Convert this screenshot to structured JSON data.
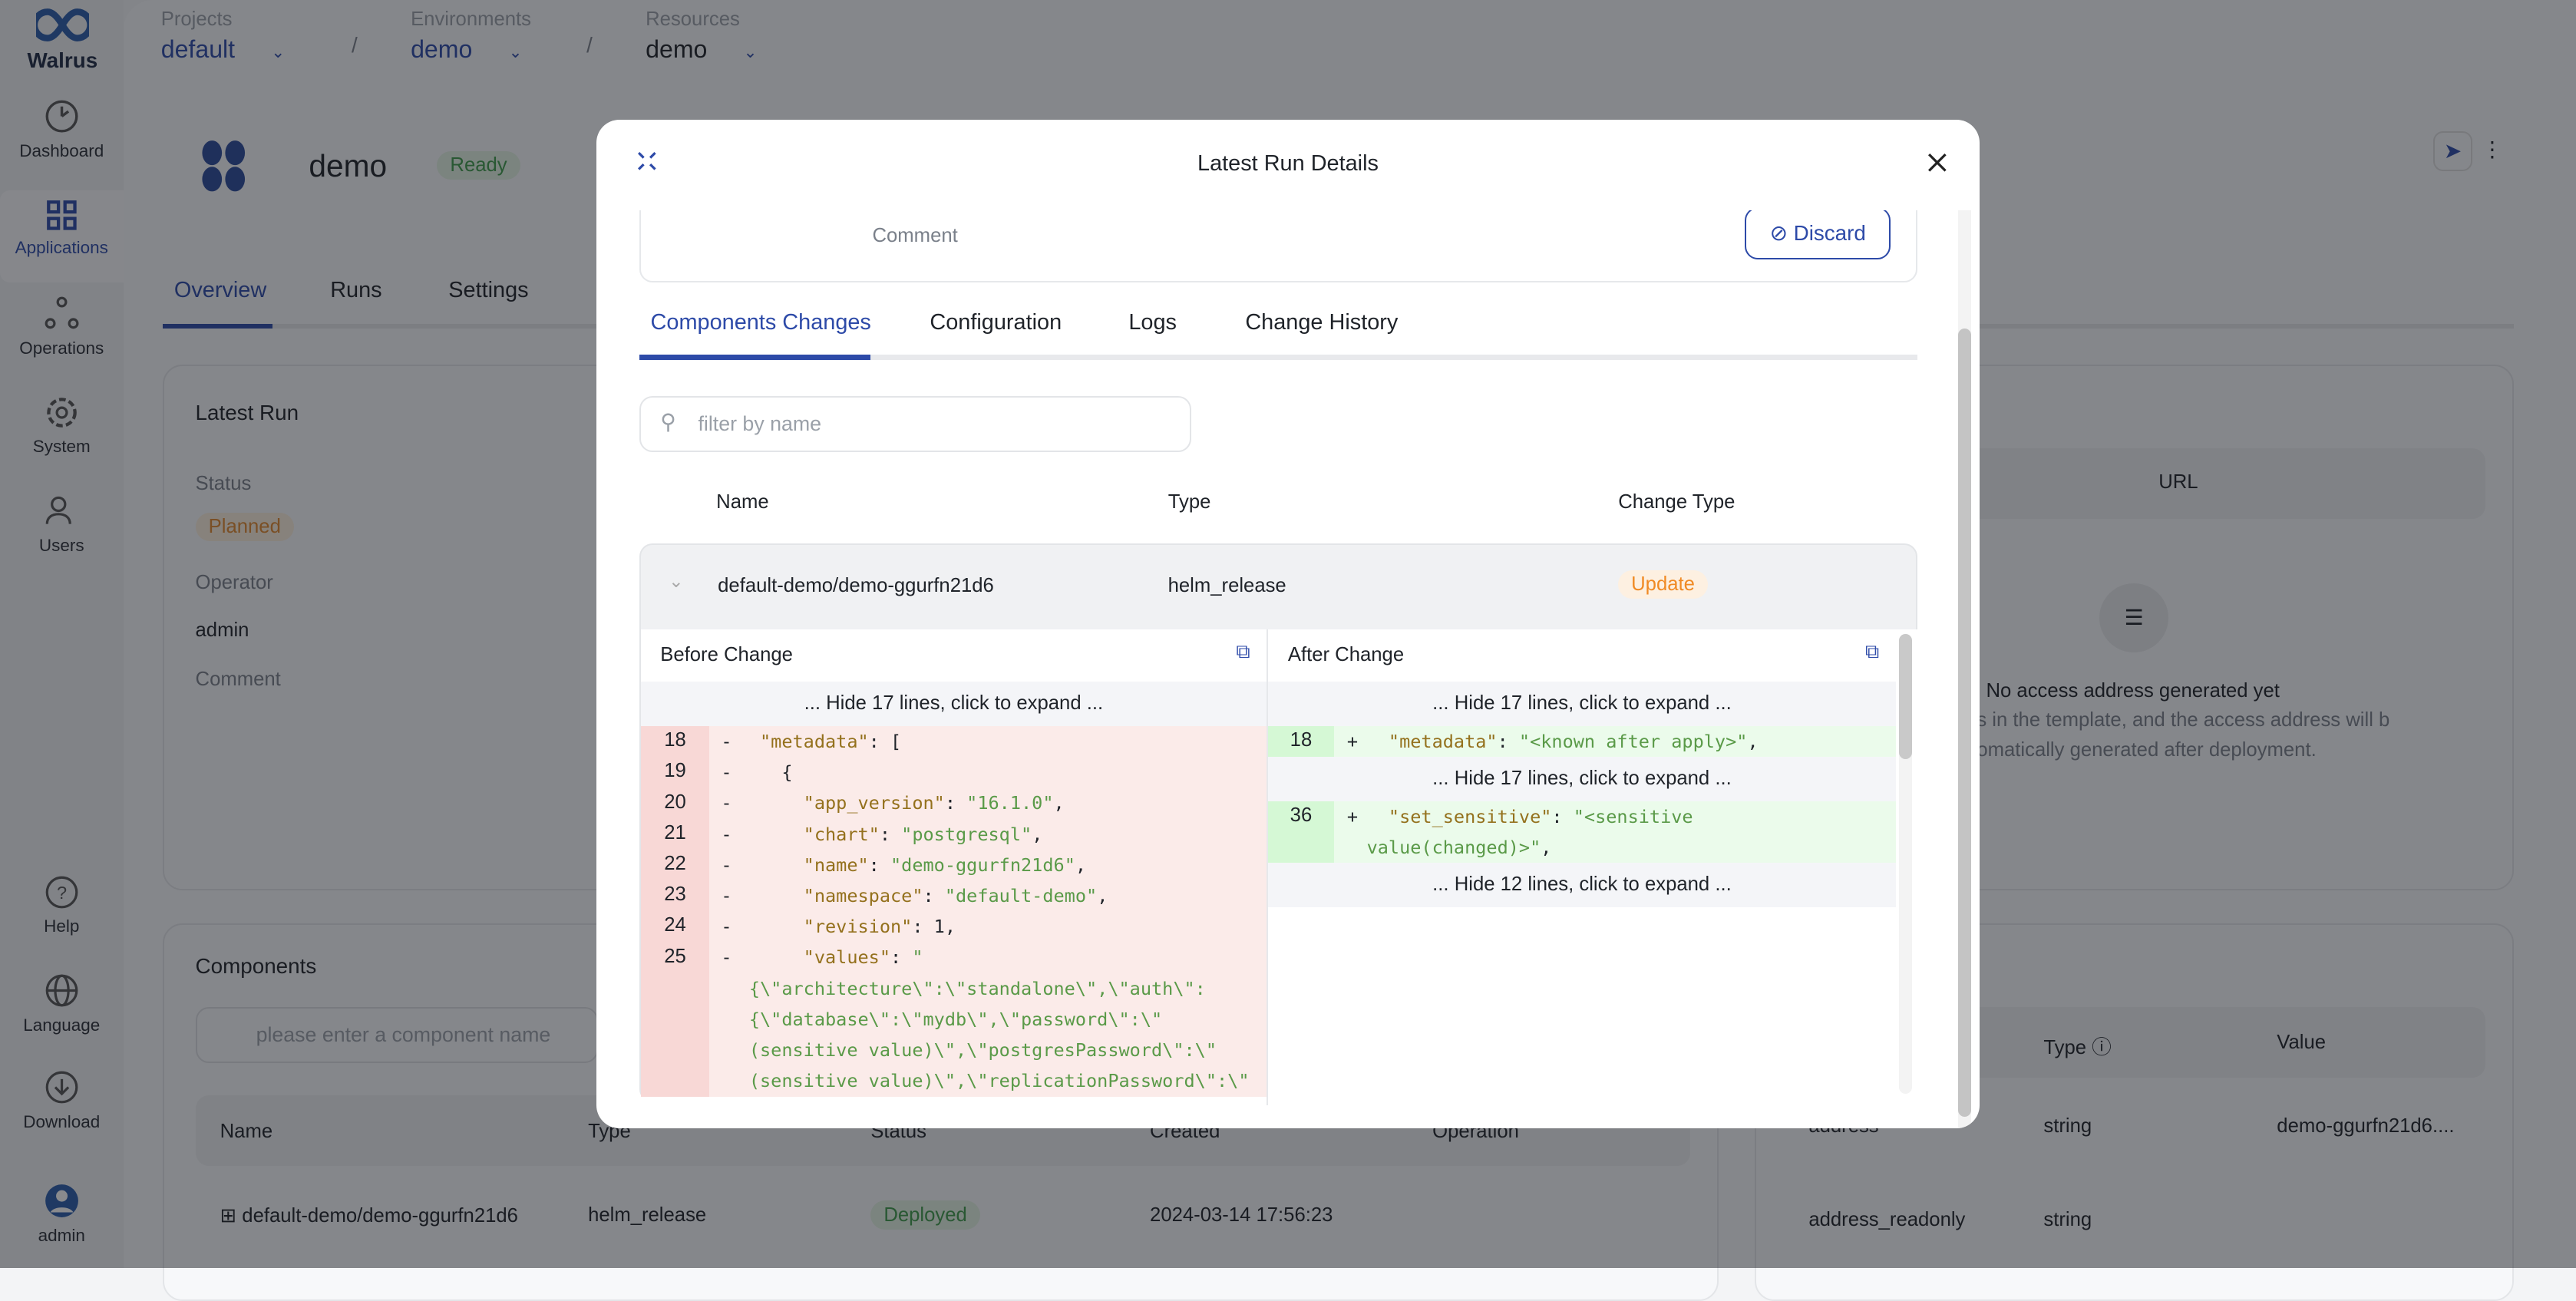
{
  "brand": {
    "name": "Walrus"
  },
  "sidebar": {
    "items": [
      {
        "label": "Dashboard",
        "icon": "dashboard-icon"
      },
      {
        "label": "Applications",
        "icon": "applications-icon",
        "active": true
      },
      {
        "label": "Operations",
        "icon": "operations-icon"
      },
      {
        "label": "System",
        "icon": "gear-icon"
      },
      {
        "label": "Users",
        "icon": "users-icon"
      }
    ],
    "bottom": [
      {
        "label": "Help",
        "icon": "help-icon"
      },
      {
        "label": "Language",
        "icon": "globe-icon"
      },
      {
        "label": "Download",
        "icon": "download-icon"
      },
      {
        "label": "admin",
        "icon": "avatar-icon"
      }
    ]
  },
  "breadcrumb": [
    {
      "label": "Projects",
      "value": "default"
    },
    {
      "label": "Environments",
      "value": "demo"
    },
    {
      "label": "Resources",
      "value": "demo"
    }
  ],
  "app": {
    "name": "demo",
    "status": "Ready",
    "tabs": [
      "Overview",
      "Runs",
      "Settings"
    ],
    "active_tab": "Overview"
  },
  "latest_run": {
    "title": "Latest Run",
    "status_label": "Status",
    "status": "Planned",
    "operator_label": "Operator",
    "operator": "admin",
    "comment_label": "Comment"
  },
  "endpoints": {
    "url_header": "URL",
    "empty_title": "No access address generated yet",
    "empty_line1": "ts in the template, and the access address will b",
    "empty_line2": "tomatically generated after deployment."
  },
  "components": {
    "title": "Components",
    "search_placeholder": "please enter a component name",
    "columns": [
      "Name",
      "Type",
      "Status",
      "Created",
      "Operation"
    ],
    "rows": [
      {
        "name": "default-demo/demo-ggurfn21d6",
        "type": "helm_release",
        "status": "Deployed",
        "created": "2024-03-14 17:56:23"
      }
    ]
  },
  "outputs": {
    "columns": [
      "Type",
      "Value"
    ],
    "rows": [
      {
        "name": "address",
        "type": "string",
        "value": "demo-ggurfn21d6...."
      },
      {
        "name": "address_readonly",
        "type": "string",
        "value": ""
      }
    ]
  },
  "modal": {
    "title": "Latest Run Details",
    "comment_label": "Comment",
    "discard_label": "Discard",
    "tabs": [
      "Components Changes",
      "Configuration",
      "Logs",
      "Change History"
    ],
    "active_tab": "Components Changes",
    "filter_placeholder": "filter by name",
    "columns": [
      "Name",
      "Type",
      "Change Type"
    ],
    "row": {
      "name": "default-demo/demo-ggurfn21d6",
      "type": "helm_release",
      "change_type": "Update"
    },
    "before": {
      "title": "Before Change",
      "hide_top": "... Hide 17 lines, click to expand ...",
      "lines": [
        {
          "num": "18",
          "tokens": [
            [
              " ",
              "p"
            ],
            [
              "\"metadata\"",
              "k"
            ],
            [
              ": [",
              "p"
            ]
          ]
        },
        {
          "num": "19",
          "tokens": [
            [
              "   {",
              "p"
            ]
          ]
        },
        {
          "num": "20",
          "tokens": [
            [
              "     ",
              "p"
            ],
            [
              "\"app_version\"",
              "k"
            ],
            [
              ": ",
              "p"
            ],
            [
              "\"16.1.0\"",
              "s"
            ],
            [
              ",",
              "p"
            ]
          ]
        },
        {
          "num": "21",
          "tokens": [
            [
              "     ",
              "p"
            ],
            [
              "\"chart\"",
              "k"
            ],
            [
              ": ",
              "p"
            ],
            [
              "\"postgresql\"",
              "s"
            ],
            [
              ",",
              "p"
            ]
          ]
        },
        {
          "num": "22",
          "tokens": [
            [
              "     ",
              "p"
            ],
            [
              "\"name\"",
              "k"
            ],
            [
              ": ",
              "p"
            ],
            [
              "\"demo-ggurfn21d6\"",
              "s"
            ],
            [
              ",",
              "p"
            ]
          ]
        },
        {
          "num": "23",
          "tokens": [
            [
              "     ",
              "p"
            ],
            [
              "\"namespace\"",
              "k"
            ],
            [
              ": ",
              "p"
            ],
            [
              "\"default-demo\"",
              "s"
            ],
            [
              ",",
              "p"
            ]
          ]
        },
        {
          "num": "24",
          "tokens": [
            [
              "     ",
              "p"
            ],
            [
              "\"revision\"",
              "k"
            ],
            [
              ": 1,",
              "p"
            ]
          ]
        },
        {
          "num": "25",
          "tokens": [
            [
              "     ",
              "p"
            ],
            [
              "\"values\"",
              "k"
            ],
            [
              ": ",
              "p"
            ],
            [
              "\"\n{\\\"architecture\\\":\\\"standalone\\\",\\\"auth\\\":\n{\\\"database\\\":\\\"mydb\\\",\\\"password\\\":\\\"\n(sensitive value)\\\",\\\"postgresPassword\\\":\\\"\n(sensitive value)\\\",\\\"replicationPassword\\\":\\\"",
              "s"
            ]
          ]
        }
      ]
    },
    "after": {
      "title": "After Change",
      "blocks": [
        {
          "hide": "... Hide 17 lines, click to expand ..."
        },
        {
          "num": "18",
          "tokens": [
            [
              "  ",
              "p"
            ],
            [
              "\"metadata\"",
              "k"
            ],
            [
              ": ",
              "p"
            ],
            [
              "\"<known after apply>\"",
              "s"
            ],
            [
              ",",
              "p"
            ]
          ]
        },
        {
          "hide": "... Hide 17 lines, click to expand ..."
        },
        {
          "num": "36",
          "tokens": [
            [
              "  ",
              "p"
            ],
            [
              "\"set_sensitive\"",
              "k"
            ],
            [
              ": ",
              "p"
            ],
            [
              "\"<sensitive\nvalue(changed)>\"",
              "s"
            ],
            [
              ",",
              "p"
            ]
          ]
        },
        {
          "hide": "... Hide 12 lines, click to expand ..."
        }
      ]
    }
  },
  "colors": {
    "accent": "#2d4aa8",
    "deleted_bg": "#fbebe9",
    "added_bg": "#ebfbeb",
    "update": "#f08a24"
  }
}
